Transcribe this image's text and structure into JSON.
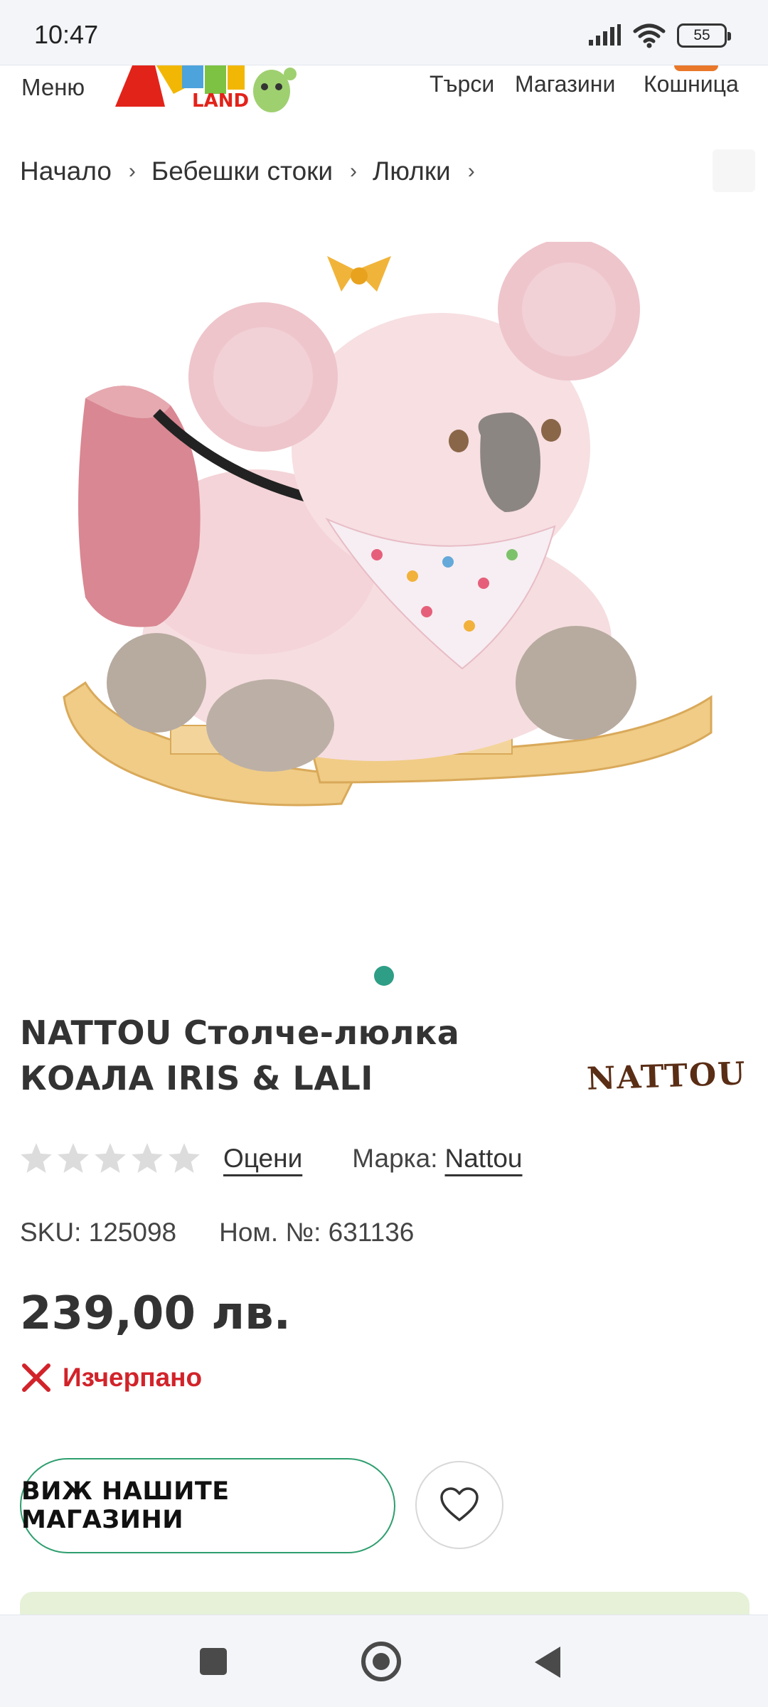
{
  "status_bar": {
    "time": "10:47",
    "battery": "55",
    "icons": [
      "signal-icon",
      "wifi-icon",
      "battery-icon"
    ]
  },
  "header": {
    "menu_label": "Меню",
    "logo_text": "LAND",
    "search_label": "Търси",
    "stores_label": "Магазини",
    "cart_label": "Кошница"
  },
  "breadcrumb": {
    "items": [
      "Начало",
      "Бебешки стоки",
      "Люлки"
    ],
    "separator": "›"
  },
  "gallery": {
    "active_dot_color": "#2e9e86"
  },
  "product": {
    "title": "NATTOU Столче-люлка КОАЛА IRIS & LALI",
    "brand_logo": "NATTOU",
    "rating_stars_filled": 0,
    "rating_stars_total": 5,
    "rate_link": "Оцени",
    "brand_label": "Марка:",
    "brand_name": "Nattou",
    "sku": "SKU: 125098",
    "model_no": "Ном. №: 631136",
    "price": "239,00 лв.",
    "stock_status": "Изчерпано",
    "stock_color": "#d2232a"
  },
  "actions": {
    "stores_button": "ВИЖ НАШИТЕ МАГАЗИНИ",
    "wishlist_icon": "heart-icon"
  },
  "nav_bar": {
    "icons": [
      "recent-apps-icon",
      "home-icon",
      "back-icon"
    ]
  }
}
